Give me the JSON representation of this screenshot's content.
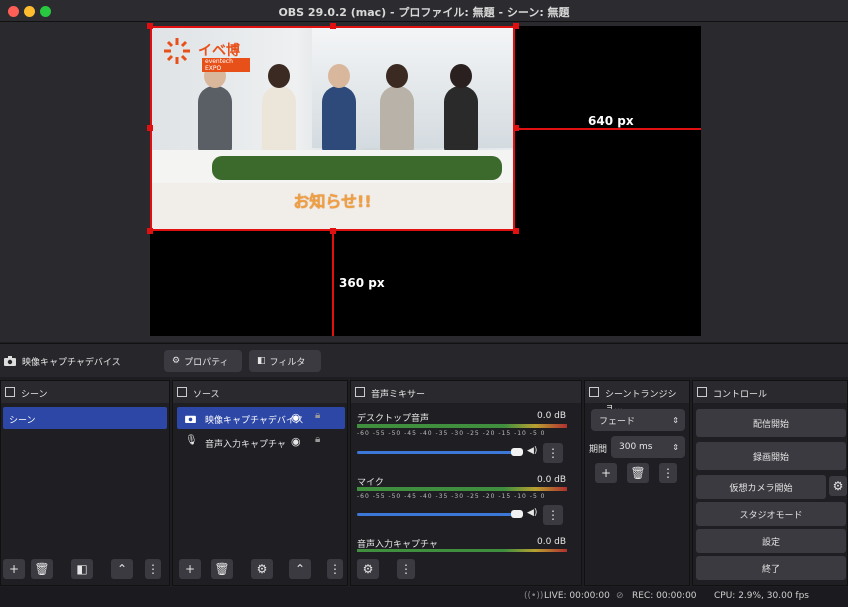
{
  "window": {
    "title": "OBS 29.0.2 (mac) - プロファイル: 無題 - シーン: 無題"
  },
  "preview": {
    "caption": "お知らせ!!",
    "logo_text": "イベ博",
    "logo_sub": "eventech EXPO",
    "width_label": "640 px",
    "height_label": "360 px"
  },
  "source_bar": {
    "selected_source": "映像キャプチャデバイス",
    "properties_label": "プロパティ",
    "filters_label": "フィルタ"
  },
  "scenes": {
    "header": "シーン",
    "items": [
      "シーン"
    ]
  },
  "sources": {
    "header": "ソース",
    "items": [
      "映像キャプチャデバイス",
      "音声入力キャプチャ"
    ]
  },
  "mixer": {
    "header": "音声ミキサー",
    "scale": "-60 -55 -50 -45 -40 -35 -30 -25 -20 -15 -10 -5 0",
    "channels": [
      {
        "name": "デスクトップ音声",
        "db": "0.0 dB"
      },
      {
        "name": "マイク",
        "db": "0.0 dB"
      },
      {
        "name": "音声入力キャプチャ",
        "db": "0.0 dB"
      }
    ]
  },
  "transitions": {
    "header": "シーントランジショ...",
    "type": "フェード",
    "duration_label": "期間",
    "duration": "300 ms"
  },
  "controls": {
    "header": "コントロール",
    "start_stream": "配信開始",
    "start_record": "録画開始",
    "virtual_cam": "仮想カメラ開始",
    "studio_mode": "スタジオモード",
    "settings": "設定",
    "exit": "終了"
  },
  "status": {
    "live": "LIVE: 00:00:00",
    "rec": "REC: 00:00:00",
    "cpu": "CPU: 2.9%, 30.00 fps"
  },
  "colors": {
    "selection": "#2c47a6",
    "bounding_box": "#e01010",
    "caption": "#f0a040"
  },
  "icons": [
    "camera-icon",
    "gear-icon",
    "filter-icon",
    "plus-icon",
    "trash-icon",
    "chevron-up-icon",
    "more-icon",
    "eye-icon",
    "lock-icon",
    "microphone-icon",
    "speaker-icon",
    "broadcast-icon",
    "record-icon"
  ]
}
